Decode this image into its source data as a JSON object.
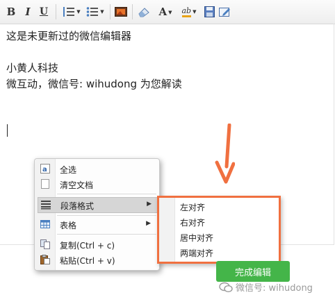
{
  "toolbar": {
    "bold_label": "B",
    "italic_label": "I",
    "underline_label": "U",
    "font_color_label": "A",
    "bg_color_label": "ab",
    "icons": [
      "bold-icon",
      "italic-icon",
      "underline-icon",
      "ordered-list-icon",
      "unordered-list-icon",
      "image-icon",
      "eraser-icon",
      "font-color-icon",
      "highlight-icon",
      "save-icon",
      "edit-icon"
    ]
  },
  "editor": {
    "lines": [
      "这是未更新过的微信编辑器",
      "小黄人科技",
      "微互动，微信号: wihudong 为您解读"
    ]
  },
  "context_menu": {
    "items": [
      {
        "label": "全选",
        "icon": "select-all-icon"
      },
      {
        "label": "清空文档",
        "icon": "clear-document-icon"
      },
      {
        "label": "段落格式",
        "icon": "paragraph-icon",
        "submenu": true
      },
      {
        "label": "表格",
        "icon": "table-icon",
        "submenu": true
      },
      {
        "label": "复制(Ctrl + c)",
        "icon": "copy-icon"
      },
      {
        "label": "粘贴(Ctrl + v)",
        "icon": "paste-icon"
      }
    ],
    "submenu_arrow": "▶"
  },
  "submenu": {
    "items": [
      "左对齐",
      "右对齐",
      "居中对齐",
      "两端对齐"
    ]
  },
  "colors": {
    "accent_arrow": "#f07040",
    "done_button": "#44b549",
    "highlight": "#d6d6d6"
  },
  "footer": {
    "done_label": "完成编辑",
    "watermark": "微信号: wihudong"
  }
}
